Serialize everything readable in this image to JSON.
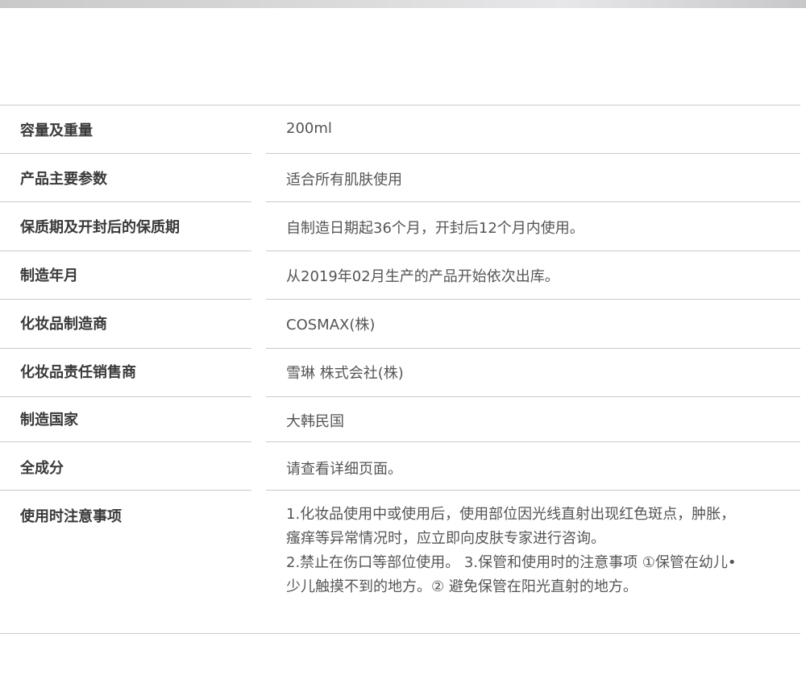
{
  "rows": [
    {
      "label": "容量及重量",
      "value": "200ml"
    },
    {
      "label": "产品主要参数",
      "value": "适合所有肌肤使用"
    },
    {
      "label": "保质期及开封后的保质期",
      "value": "自制造日期起36个月，开封后12个月内使用。"
    },
    {
      "label": "制造年月",
      "value": "从2019年02月生产的产品开始依次出库。"
    },
    {
      "label": "化妆品制造商",
      "value": "COSMAX(株)"
    },
    {
      "label": "化妆品责任销售商",
      "value": "雪琳 株式会社(株)"
    },
    {
      "label": "制造国家",
      "value": "大韩民国"
    },
    {
      "label": "全成分",
      "value": "请查看详细页面。"
    }
  ],
  "notes": {
    "label": "使用时注意事项",
    "lines": [
      "1.化妆品使用中或使用后，使用部位因光线直射出现红色斑点，肿胀，",
      "瘙痒等异常情况时，应立即向皮肤专家进行咨询。",
      "2.禁止在伤口等部位使用。 3.保管和使用时的注意事项 ①保管在幼儿•",
      "少儿触摸不到的地方。② 避免保管在阳光直射的地方。"
    ]
  }
}
